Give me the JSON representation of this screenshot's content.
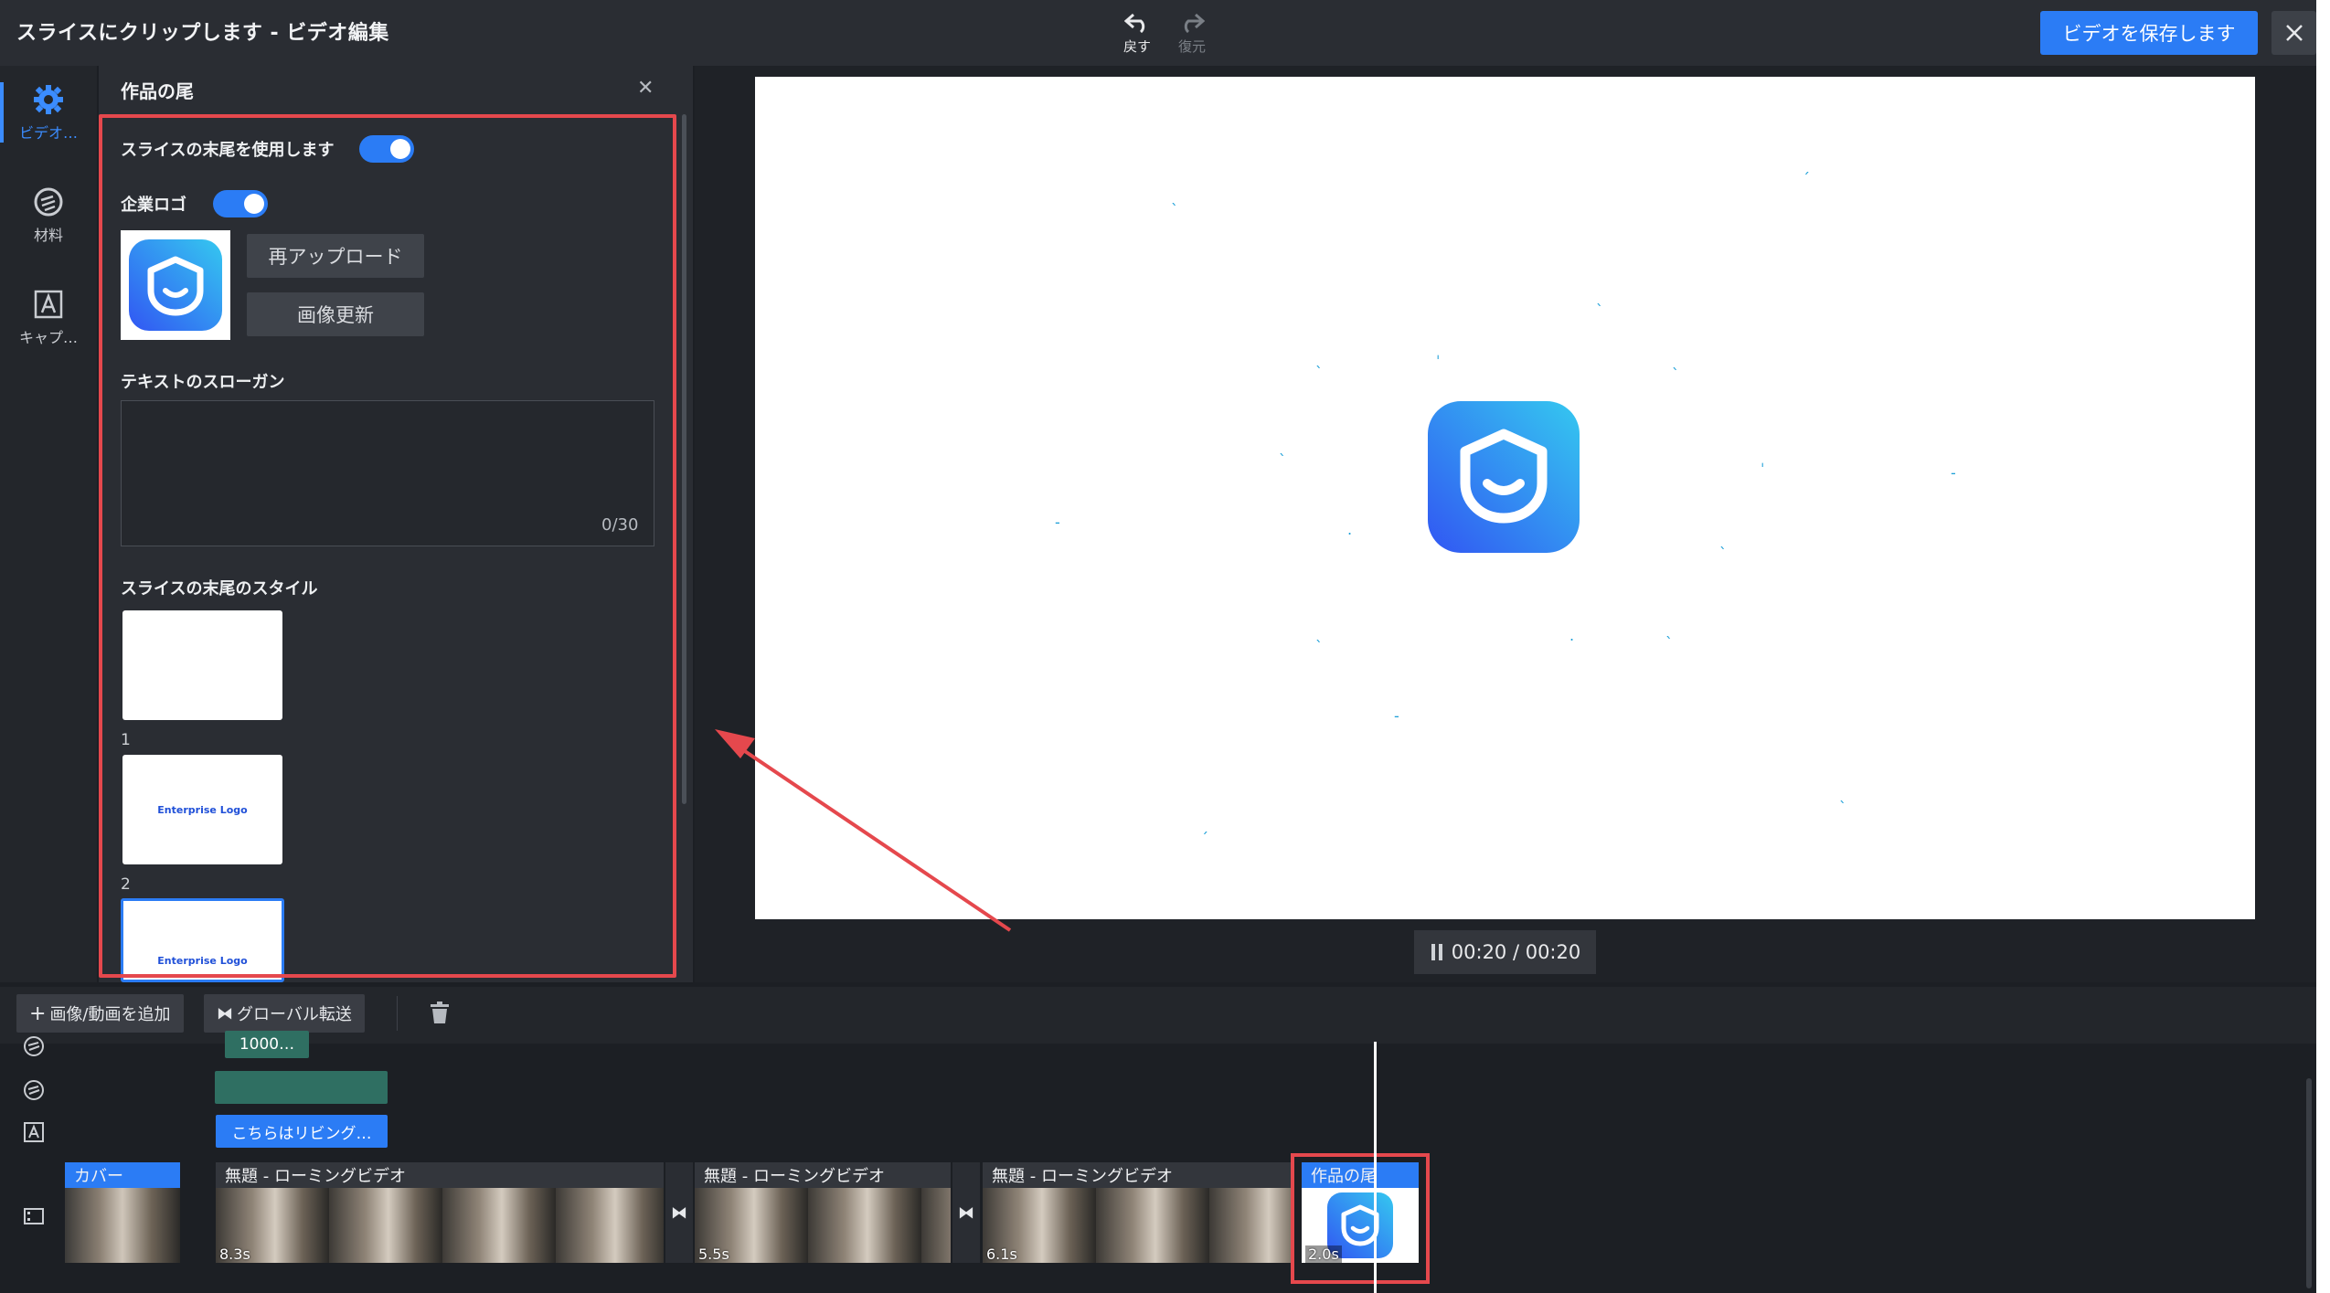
{
  "app": {
    "title": "スライスにクリップします - ビデオ編集",
    "undo_label": "戻す",
    "redo_label": "復元",
    "save_label": "ビデオを保存します"
  },
  "rail": {
    "items": [
      {
        "label": "ビデオ…",
        "icon": "gear-icon"
      },
      {
        "label": "材料",
        "icon": "palette-icon"
      },
      {
        "label": "キャプ…",
        "icon": "caption-icon"
      }
    ]
  },
  "panel": {
    "title": "作品の尾",
    "use_ending_label": "スライスの末尾を使用します",
    "company_logo_label": "企業ロゴ",
    "reupload_label": "再アップロード",
    "update_image_label": "画像更新",
    "slogan_label": "テキストのスローガン",
    "slogan_value": "",
    "slogan_count": "0/30",
    "style_label": "スライスの末尾のスタイル",
    "style_items": [
      {
        "num": "1",
        "text": ""
      },
      {
        "num": "2",
        "text": "Enterprise Logo"
      },
      {
        "num": "",
        "text": "Enterprise Logo"
      }
    ]
  },
  "player": {
    "time": "00:20 / 00:20"
  },
  "timeline": {
    "add_label": "画像/動画を追加",
    "global_transition_label": "グローバル転送",
    "chip_text": "1000…",
    "caption_chip": "こちらはリビング…",
    "clips": [
      {
        "title": "カバー",
        "duration": ""
      },
      {
        "title": "無題 - ローミングビデオ",
        "duration": "8.3s"
      },
      {
        "title": "無題 - ローミングビデオ",
        "duration": "5.5s"
      },
      {
        "title": "無題 - ローミングビデオ",
        "duration": "6.1s"
      },
      {
        "title": "作品の尾",
        "duration": "2.0s"
      }
    ]
  },
  "colors": {
    "accent": "#2b7cf5",
    "highlight": "#e5484d",
    "tail_chip": "#2f6f62"
  }
}
